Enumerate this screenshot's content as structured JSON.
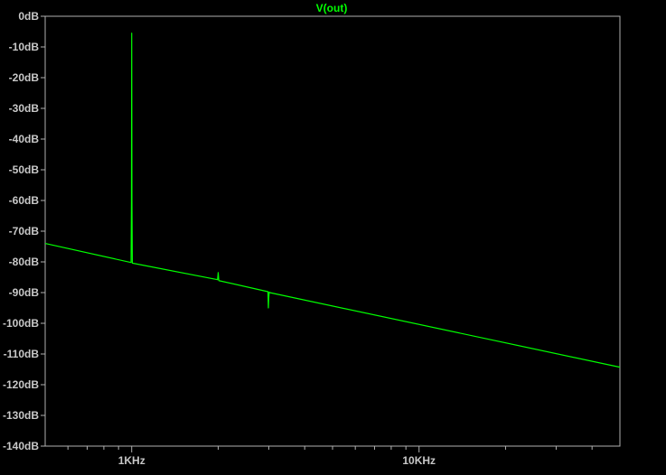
{
  "window": {
    "background": "#000000",
    "axis_color": "#b0b0b0",
    "text_color": "#c8c8c8"
  },
  "chart_data": {
    "type": "line",
    "title": "V(out)",
    "xscale": "log",
    "yunit": "dB",
    "xlim": [
      500,
      50000
    ],
    "ylim": [
      -140,
      0
    ],
    "y_ticks": [
      {
        "value": 0,
        "label": "0dB"
      },
      {
        "value": -10,
        "label": "-10dB"
      },
      {
        "value": -20,
        "label": "-20dB"
      },
      {
        "value": -30,
        "label": "-30dB"
      },
      {
        "value": -40,
        "label": "-40dB"
      },
      {
        "value": -50,
        "label": "-50dB"
      },
      {
        "value": -60,
        "label": "-60dB"
      },
      {
        "value": -70,
        "label": "-70dB"
      },
      {
        "value": -80,
        "label": "-80dB"
      },
      {
        "value": -90,
        "label": "-90dB"
      },
      {
        "value": -100,
        "label": "-100dB"
      },
      {
        "value": -110,
        "label": "-110dB"
      },
      {
        "value": -120,
        "label": "-120dB"
      },
      {
        "value": -130,
        "label": "-130dB"
      },
      {
        "value": -140,
        "label": "-140dB"
      }
    ],
    "x_ticks_major": [
      {
        "value": 1000,
        "label": "1KHz"
      },
      {
        "value": 10000,
        "label": "10KHz"
      }
    ],
    "x_ticks_minor": [
      600,
      700,
      800,
      900,
      2000,
      3000,
      4000,
      5000,
      6000,
      7000,
      8000,
      9000,
      20000,
      30000,
      40000
    ],
    "grid": false,
    "series": [
      {
        "name": "V(out)",
        "color": "#00ff00",
        "points": [
          [
            500,
            -74.0
          ],
          [
            995,
            -80.2
          ],
          [
            998,
            -60.0
          ],
          [
            1000,
            -5.5
          ],
          [
            1002,
            -60.0
          ],
          [
            1005,
            -80.4
          ],
          [
            1990,
            -85.8
          ],
          [
            2000,
            -83.5
          ],
          [
            2010,
            -86.1
          ],
          [
            2980,
            -89.7
          ],
          [
            2990,
            -95.0
          ],
          [
            3000,
            -91.5
          ],
          [
            3010,
            -89.8
          ],
          [
            3020,
            -90.0
          ],
          [
            50000,
            -114.3
          ]
        ]
      }
    ]
  }
}
